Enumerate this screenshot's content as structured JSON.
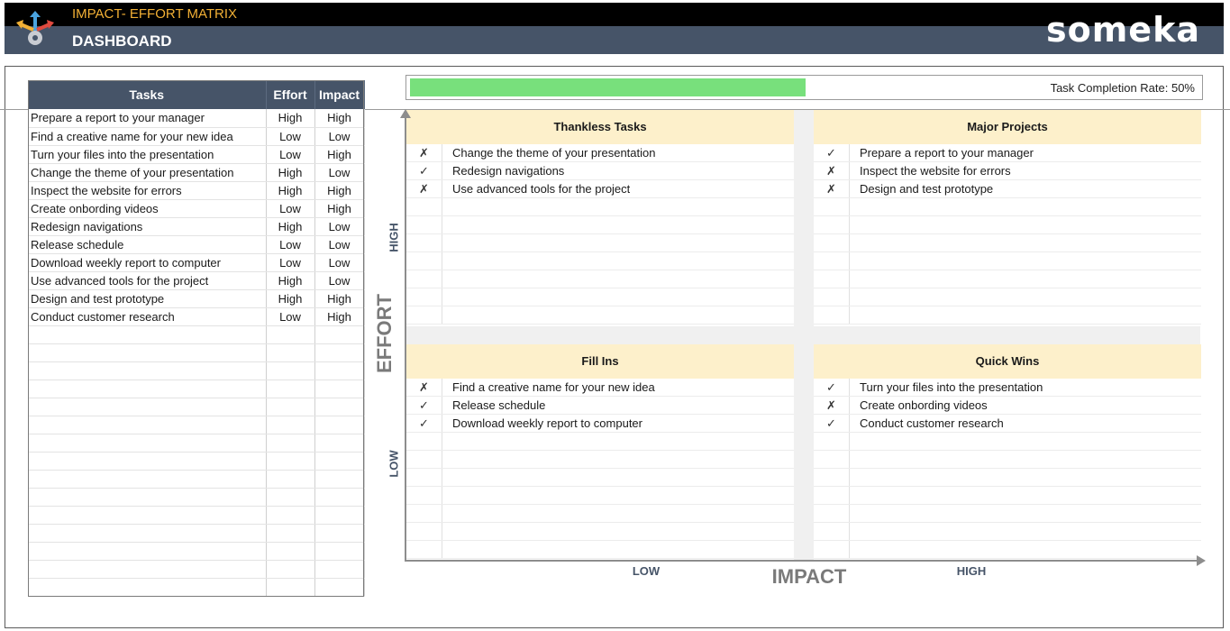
{
  "header": {
    "app_title": "IMPACT- EFFORT MATRIX",
    "page_title": "DASHBOARD",
    "brand": "someka",
    "logo_icon": "arrows-gear-icon",
    "colors": {
      "header_bg": "#465468",
      "title_accent": "#f2b035"
    }
  },
  "table": {
    "headers": [
      "Tasks",
      "Effort",
      "Impact"
    ],
    "rows": [
      [
        "Prepare a report to your manager",
        "High",
        "High"
      ],
      [
        "Find a creative name for your new idea",
        "Low",
        "Low"
      ],
      [
        "Turn your files into the presentation",
        "Low",
        "High"
      ],
      [
        "Change the theme of your presentation",
        "High",
        "Low"
      ],
      [
        "Inspect the website for errors",
        "High",
        "High"
      ],
      [
        "Create onbording videos",
        "Low",
        "High"
      ],
      [
        "Redesign navigations",
        "High",
        "Low"
      ],
      [
        "Release schedule",
        "Low",
        "Low"
      ],
      [
        "Download weekly report to computer",
        "Low",
        "Low"
      ],
      [
        "Use advanced tools for the project",
        "High",
        "Low"
      ],
      [
        "Design and test prototype",
        "High",
        "High"
      ],
      [
        "Conduct customer research",
        "Low",
        "High"
      ]
    ],
    "empty_rows": 15
  },
  "progress": {
    "label": "Task Completion Rate: 50%",
    "rate": 0.5,
    "color": "#78e07c"
  },
  "axes": {
    "y_title": "EFFORT",
    "y_high": "HIGH",
    "y_low": "LOW",
    "x_title": "IMPACT",
    "x_low": "LOW",
    "x_high": "HIGH"
  },
  "quadrants": {
    "thankless": {
      "title": "Thankless Tasks",
      "items": [
        {
          "mark": "✗",
          "text": "Change the theme of your presentation"
        },
        {
          "mark": "✓",
          "text": "Redesign navigations"
        },
        {
          "mark": "✗",
          "text": "Use advanced tools for the project"
        }
      ]
    },
    "major": {
      "title": "Major Projects",
      "items": [
        {
          "mark": "✓",
          "text": "Prepare a report to your manager"
        },
        {
          "mark": "✗",
          "text": "Inspect the website for errors"
        },
        {
          "mark": "✗",
          "text": "Design and test prototype"
        }
      ]
    },
    "fillins": {
      "title": "Fill Ins",
      "items": [
        {
          "mark": "✗",
          "text": "Find a creative name for your new idea"
        },
        {
          "mark": "✓",
          "text": "Release schedule"
        },
        {
          "mark": "✓",
          "text": "Download weekly report to computer"
        }
      ]
    },
    "quickwins": {
      "title": "Quick Wins",
      "items": [
        {
          "mark": "✓",
          "text": "Turn your files into the presentation"
        },
        {
          "mark": "✗",
          "text": "Create onbording videos"
        },
        {
          "mark": "✓",
          "text": "Conduct customer research"
        }
      ]
    },
    "rows_per_quadrant": 10
  }
}
